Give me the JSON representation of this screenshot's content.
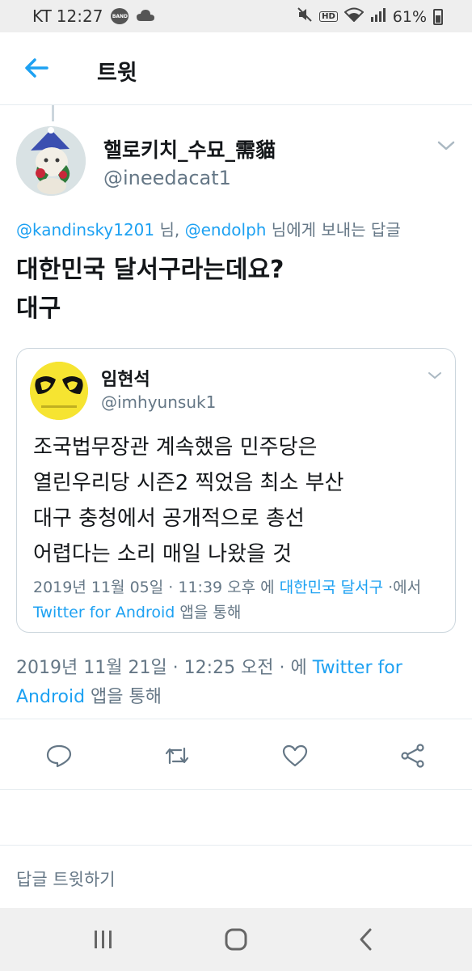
{
  "status_bar": {
    "carrier": "KT",
    "time": "12:27",
    "band_badge": "BAND",
    "hd_badge": "HD",
    "battery": "61%",
    "icons": [
      "band-icon",
      "cloud-icon",
      "mute-icon",
      "hd-icon",
      "wifi-icon",
      "signal-icon",
      "battery-icon"
    ]
  },
  "header": {
    "title": "트윗",
    "back_icon": "back-arrow-icon"
  },
  "colors": {
    "accent": "#1da1f2",
    "text": "#14171a",
    "secondary": "#657786",
    "border": "#e6ecf0"
  },
  "tweet": {
    "display_name": "핼로키치_수묘_需貓",
    "handle": "@ineedacat1",
    "reply_mention_1": "@kandinsky1201",
    "reply_sep_1": " 님, ",
    "reply_mention_2": "@endolph",
    "reply_suffix": " 님에게 보내는 답글",
    "text_lines": [
      "대한민국 달서구라는데요?",
      "대구"
    ],
    "date": "2019년 11월 21일",
    "dot_1": " · ",
    "time": "12:25 오전",
    "dot_2": " · ",
    "via_prefix": "에 ",
    "client": "Twitter for Android",
    "via_suffix": " 앱을 통해"
  },
  "quoted_tweet": {
    "display_name": "임현석",
    "handle": "@imhyunsuk1",
    "text_lines": [
      "조국법무장관 계속했음 민주당은",
      "열린우리당 시즌2  찍었음 최소 부산",
      "대구 충청에서 공개적으로 총선",
      "어렵다는 소리 매일 나왔을 것"
    ],
    "date": "2019년 11월 05일",
    "sep_1": " · ",
    "time": "11:39 오후",
    "at_prefix": " 에 ",
    "location": "대한민국 달서구",
    "from_text": " ·에서 ",
    "client": "Twitter for Android",
    "via_suffix": " 앱을 통해"
  },
  "actions": [
    "reply-icon",
    "retweet-icon",
    "like-icon",
    "share-icon"
  ],
  "reply_bar": {
    "placeholder": "답글 트윗하기"
  },
  "nav_bar": [
    "recents-icon",
    "home-icon",
    "back-icon"
  ]
}
